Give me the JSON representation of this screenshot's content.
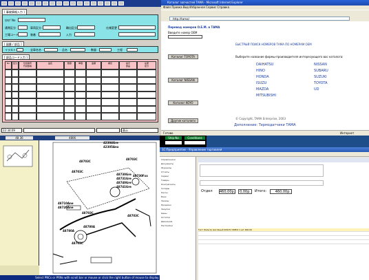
{
  "q1": {
    "sec_order": "[ 事故情報入力 ]",
    "sec_part": "[ 部品コード入力 ]",
    "sec_illus": "[ 図番 / 部品 ]",
    "labels": {
      "l1": "ｶﾀﾛｸﾞNo",
      "l2": "通常区分",
      "l3": "車両区分",
      "l4": "輸出区分",
      "l5": "仕様変更",
      "l6": "工場コード",
      "l7": "装着",
      "l8": "入力",
      "l9": "イラスト",
      "l10": "全車名名",
      "l11": "品名",
      "l12": "数量",
      "l13": "工程"
    },
    "table_headers": [
      "No",
      "区分",
      "仕様番号\n代替部番",
      "品名",
      "数量",
      "単価",
      "金額",
      "補足",
      "指示\n部品",
      "在庫\n区分"
    ],
    "status_time": "22:34:09",
    "status_right": "表示"
  },
  "q2": {
    "title": "Каталог запчастей ТАМА - Microsoft Internet Explorer",
    "menu": "Файл  Правка  Вид  Избранное  Сервис  Справка",
    "address": "http://tama/",
    "head": "Перевод номеров O.E.M. в ТАМА",
    "head_right": "БЫСТРЫЙ ПОИСК НОМЕРОВ ТАМА ПО НОМЕРАМ OEM",
    "input_label": "Введите номер OEM",
    "choose_text": "Выберите название фирмы-производителя интересующего вас каталога:",
    "btn1": "Каталог TOYOTA",
    "btn2": "Каталог NISSAN",
    "btn3": "Каталог KOYO",
    "btn4": "Другие каталоги",
    "brands_left": [
      "DAIHATSU",
      "HINO",
      "HONDA",
      "ISUZU",
      "MAZDA",
      "MITSUBISHI"
    ],
    "brands_right": [
      "NISSAN",
      "SUBARU",
      "SUZUKI",
      "TOYOTA",
      "UD"
    ],
    "footer_link": "Дополнение: Термодатчики ТАМА",
    "copyright": "© Copyright, TAMA Enterprise, 2003",
    "status": "Готово",
    "status_right": "Интернет"
  },
  "q3": {
    "status": "Select PNCs or PRNs with scroll bar or mouse or click the right button of mouse to display a details",
    "top_left": "48 36",
    "top_mid1": "4806",
    "top_mid2": "Ship No",
    "top_right": "Conditions",
    "part_labels": [
      "42304Gre",
      "42305Anx",
      "48703C",
      "48703C",
      "48730Gre",
      "48731Gre",
      "48740Gre",
      "48741Gre",
      "48730Fxx",
      "48703C",
      "48710Ane",
      "48720Ane",
      "48703C",
      "48780A",
      "48780A",
      "48703C",
      "48703C"
    ]
  },
  "q4": {
    "title": "1С:Предприятие - Управление торговлей",
    "amount1": "460,00р.",
    "amount2": "0,00р.",
    "amount3": "460,00р.",
    "label_total": "Итого:",
    "rows": [
      "Тест  Фильтр масляный 90915-YZZD2  1 шт  460,00",
      "",
      "",
      ""
    ],
    "left_items": [
      "Справочники",
      "Документы",
      "Журналы",
      "Отчеты",
      "Сервис",
      "Товары",
      "Контрагенты",
      "Склады",
      "Кассы",
      "Банк",
      "Заказы",
      "Продажи",
      "Закупки",
      "Цены",
      "Остатки",
      "Движения",
      "Настройки"
    ]
  }
}
